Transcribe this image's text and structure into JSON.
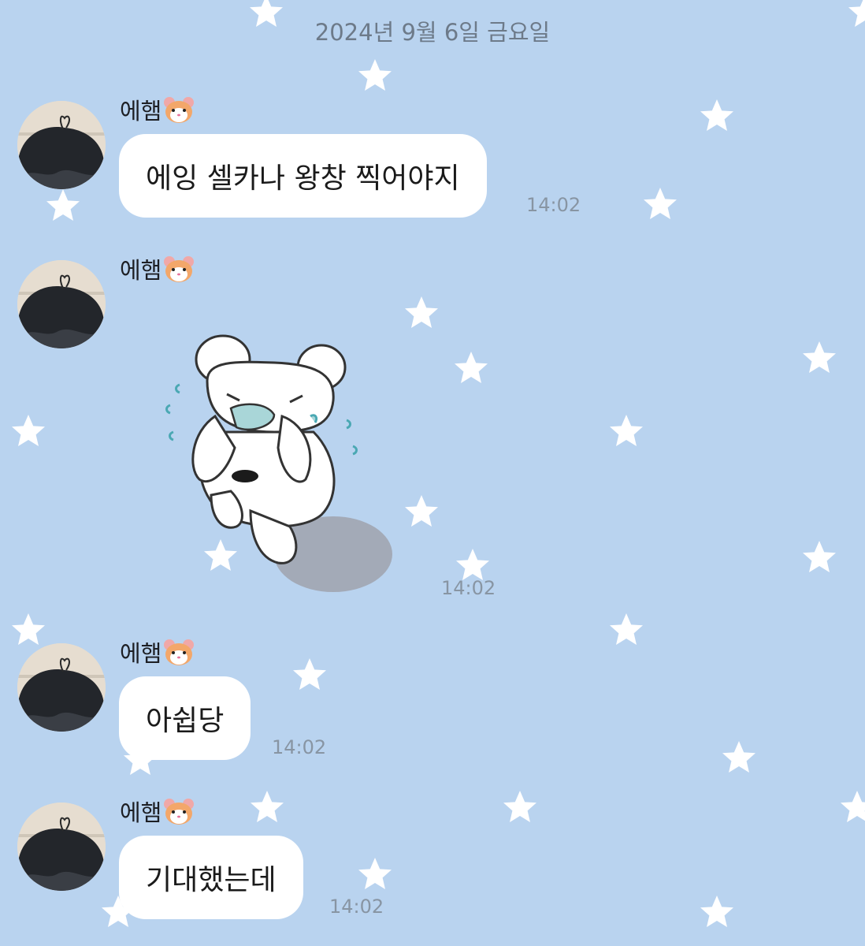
{
  "chat": {
    "date_divider": "2024년 9월 6일 금요일",
    "messages": [
      {
        "sender": "에햄",
        "sender_emoji": "hamster-face-emoji",
        "text": "에잉 셀카나 왕창 찍어야지",
        "time": "14:02"
      },
      {
        "sender": "에햄",
        "sender_emoji": "hamster-face-emoji",
        "sticker": "crying-white-bear-sticker",
        "time": "14:02"
      },
      {
        "sender": "에햄",
        "sender_emoji": "hamster-face-emoji",
        "text": "아쉽당",
        "time": "14:02"
      },
      {
        "sender": "에햄",
        "sender_emoji": "hamster-face-emoji",
        "text": "기대했는데",
        "time": "14:02"
      }
    ]
  },
  "theme": {
    "background": "#b9d3ef",
    "bubble": "#ffffff",
    "star": "#ffffff"
  }
}
